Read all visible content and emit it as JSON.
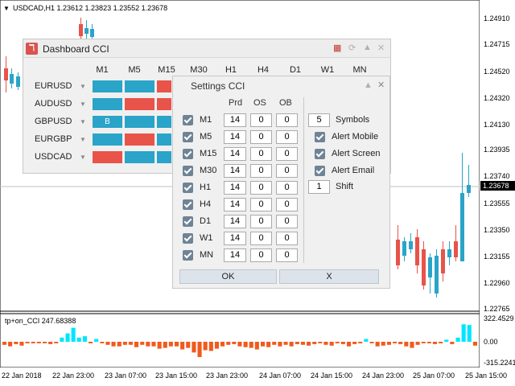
{
  "chart": {
    "title": "USDCAD,H1  1.23612 1.23823 1.23552 1.23678",
    "current_price": "1.23678",
    "price_labels": [
      "1.24910",
      "1.24715",
      "1.24520",
      "1.24320",
      "1.24130",
      "1.23935",
      "1.23740",
      "1.23555",
      "1.23350",
      "1.23155",
      "1.22960",
      "1.22765"
    ],
    "time_labels": [
      "22 Jan 2018",
      "22 Jan 23:00",
      "23 Jan 07:00",
      "23 Jan 15:00",
      "23 Jan 23:00",
      "24 Jan 07:00",
      "24 Jan 15:00",
      "24 Jan 23:00",
      "25 Jan 07:00",
      "25 Jan 15:00"
    ],
    "cci": {
      "title": "tp+on_CCI 247.68388",
      "scale": [
        "322.4529",
        "0.00",
        "-315.2241"
      ],
      "values": [
        -40,
        -60,
        -30,
        -50,
        -20,
        -20,
        -20,
        -20,
        -30,
        -20,
        60,
        120,
        200,
        60,
        80,
        -20,
        40,
        -20,
        -40,
        -60,
        -60,
        -40,
        -40,
        -70,
        -40,
        -60,
        -60,
        -90,
        -80,
        -60,
        -60,
        -100,
        -80,
        -140,
        -200,
        -110,
        -120,
        -90,
        -60,
        -40,
        -30,
        -60,
        -70,
        -80,
        -100,
        -60,
        -70,
        -40,
        -60,
        -40,
        -60,
        -30,
        -40,
        -50,
        -30,
        -20,
        -40,
        -50,
        -20,
        -30,
        -60,
        -30,
        -20,
        40,
        -20,
        -60,
        -50,
        -40,
        -20,
        -30,
        -60,
        -80,
        -40,
        -20,
        -20,
        -30,
        -20,
        30,
        -30,
        60,
        250,
        240,
        -50
      ]
    }
  },
  "dashboard": {
    "title": "Dashboard CCI",
    "timeframes": [
      "M1",
      "M5",
      "M15",
      "M30",
      "H1",
      "H4",
      "D1",
      "W1",
      "MN"
    ],
    "symbols": [
      "EURUSD",
      "AUDUSD",
      "GBPUSD",
      "EURGBP",
      "USDCAD"
    ],
    "grid": [
      [
        "#2aa4c8",
        "#2aa4c8",
        "#e8534a"
      ],
      [
        "#2aa4c8",
        "#e8534a",
        "#e8534a"
      ],
      [
        "#2aa4c8",
        "#2aa4c8",
        "#2aa4c8"
      ],
      [
        "#2aa4c8",
        "#e8534a",
        "#2aa4c8"
      ],
      [
        "#e8534a",
        "#2aa4c8",
        "#2aa4c8"
      ]
    ],
    "cell_text": {
      "row": 2,
      "col": 0,
      "text": "B"
    }
  },
  "settings": {
    "title": "Settings CCI",
    "headers": {
      "prd": "Prd",
      "os": "OS",
      "ob": "OB"
    },
    "rows": [
      {
        "tf": "M1",
        "prd": "14",
        "os": "0",
        "ob": "0"
      },
      {
        "tf": "M5",
        "prd": "14",
        "os": "0",
        "ob": "0"
      },
      {
        "tf": "M15",
        "prd": "14",
        "os": "0",
        "ob": "0"
      },
      {
        "tf": "M30",
        "prd": "14",
        "os": "0",
        "ob": "0"
      },
      {
        "tf": "H1",
        "prd": "14",
        "os": "0",
        "ob": "0"
      },
      {
        "tf": "H4",
        "prd": "14",
        "os": "0",
        "ob": "0"
      },
      {
        "tf": "D1",
        "prd": "14",
        "os": "0",
        "ob": "0"
      },
      {
        "tf": "W1",
        "prd": "14",
        "os": "0",
        "ob": "0"
      },
      {
        "tf": "MN",
        "prd": "14",
        "os": "0",
        "ob": "0"
      }
    ],
    "symbols_value": "5",
    "symbols_label": "Symbols",
    "alert_mobile": "Alert Mobile",
    "alert_screen": "Alert Screen",
    "alert_email": "Alert Email",
    "shift_value": "1",
    "shift_label": "Shift",
    "ok_label": "OK",
    "cancel_label": "X"
  },
  "colors": {
    "bull": "#2aa4c8",
    "bear": "#e8534a",
    "cci_up": "#00e5ff",
    "cci_down": "#f05a1e"
  }
}
